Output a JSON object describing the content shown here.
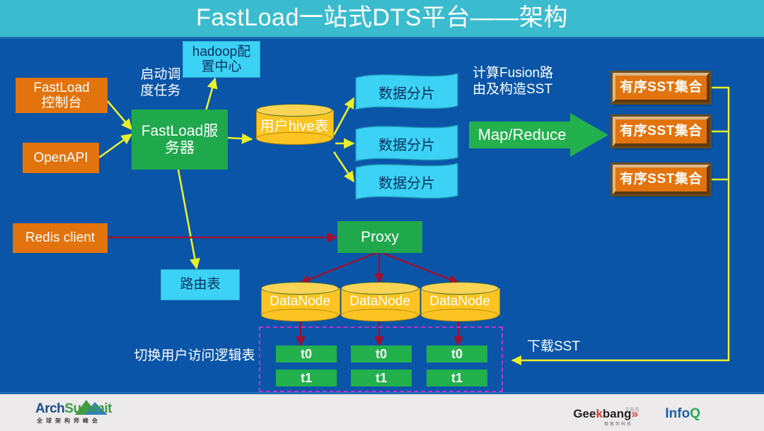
{
  "title": "FastLoad一站式DTS平台——架构",
  "colors": {
    "header_bg": "#3bbcce",
    "canvas_bg": "#0a55a8",
    "orange": "#e2730d",
    "green": "#1fa84c",
    "cyan": "#3bd2f5",
    "yellow_cylinder": "#fcc422",
    "arrow_yellow": "#e8f02a",
    "arrow_red": "#a01030",
    "dashed_magenta": "#c72fd0",
    "footer_bg": "#eceaea"
  },
  "nodes": {
    "fastload_console": "FastLoad\n控制台",
    "openapi": "OpenAPI",
    "fastload_server": "FastLoad服\n务器",
    "hadoop_config": "hadoop配\n置中心",
    "hive_table": "用户hive表",
    "data_shards": [
      "数据分片",
      "数据分片",
      "数据分片"
    ],
    "mapreduce": "Map/Reduce",
    "sst_sets": [
      "有序SST集合",
      "有序SST集合",
      "有序SST集合"
    ],
    "redis_client": "Redis client",
    "route_table": "路由表",
    "proxy": "Proxy",
    "datanodes": [
      "DataNode",
      "DataNode",
      "DataNode"
    ],
    "tables": [
      {
        "t0": "t0",
        "t1": "t1"
      },
      {
        "t0": "t0",
        "t1": "t1"
      },
      {
        "t0": "t0",
        "t1": "t1"
      }
    ]
  },
  "labels": {
    "start_schedule_task": "启动调\n度任务",
    "compute_fusion": "计算Fusion路\n由及构造SST",
    "switch_logical_table": "切换用户访问逻辑表",
    "download_sst": "下载SST"
  },
  "footer": {
    "arch": "Arch",
    "summit": "Summit",
    "arch_sub": "全球架构师峰会",
    "sponsor_note": "主办方",
    "geek": "Gee",
    "geek_k": "k",
    "geek_bang": "bang",
    "geek_chev": "»",
    "geek_sub": "极客邦科技",
    "infoq": "Info",
    "infoq_q": "Q"
  }
}
